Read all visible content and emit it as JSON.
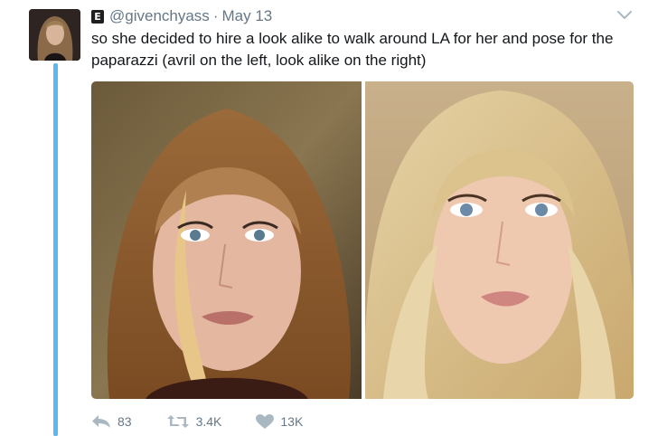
{
  "tweet": {
    "badge": "E",
    "handle": "@givenchyass",
    "separator": "·",
    "date": "May 13",
    "text": "so she decided to hire a look alike to walk around LA for her and pose for the paparazzi (avril on the left, look alike on the right)",
    "menu_icon": "chevron-down-icon"
  },
  "actions": {
    "reply_count": "83",
    "retweet_count": "3.4K",
    "like_count": "13K",
    "reply_icon": "reply-icon",
    "retweet_icon": "retweet-icon",
    "like_icon": "heart-icon"
  },
  "colors": {
    "thread_line": "#5bb8ee",
    "meta_gray": "#657786",
    "text": "#14171a"
  }
}
